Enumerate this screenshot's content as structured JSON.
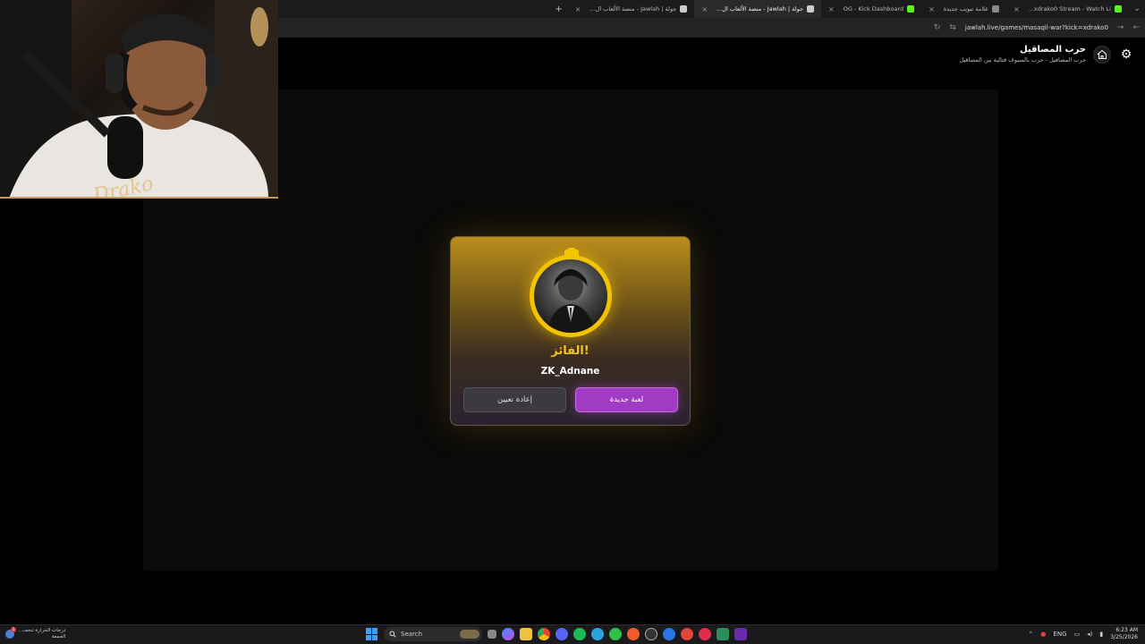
{
  "browser": {
    "tabs": [
      {
        "title": "xdrako0 Stream - Watch Li...",
        "favicon_color": "#53fc18",
        "active": false
      },
      {
        "title": "علامة تبويب جديدة",
        "favicon_color": "#888888",
        "active": false
      },
      {
        "title": "OG - Kick Dashboard",
        "favicon_color": "#53fc18",
        "active": false
      },
      {
        "title": "جولة | Jawlah - منصة الألعاب ال...",
        "favicon_color": "#cccccc",
        "active": true
      },
      {
        "title": "جولة | Jawlah - منصة الألعاب ال...",
        "favicon_color": "#cccccc",
        "active": false
      }
    ],
    "new_tab": "+",
    "url": "jawlah.live/games/masaqil-war?kick=xdrako0"
  },
  "site_header": {
    "title": "حرب المصاقيل",
    "subtitle": "حرب المصاقيل - حرب بالسيوف قتالية بين المصاقيل"
  },
  "modal": {
    "winner_label": "الفائز!",
    "winner_name": "ZK_Adnane",
    "new_game_button": "لعبة جديدة",
    "reset_button": "إعادة تعيين",
    "accent_gold": "#f2c400",
    "accent_purple": "#a23bc4"
  },
  "webcam": {
    "signature": "Drako"
  },
  "taskbar": {
    "weather_line1": "درجات الحرارة تنخف...",
    "weather_line2": "الجمعة",
    "weather_badge": "1",
    "search_label": "Search",
    "language": "ENG",
    "time": "6:23 AM",
    "date": "3/25/2026"
  }
}
